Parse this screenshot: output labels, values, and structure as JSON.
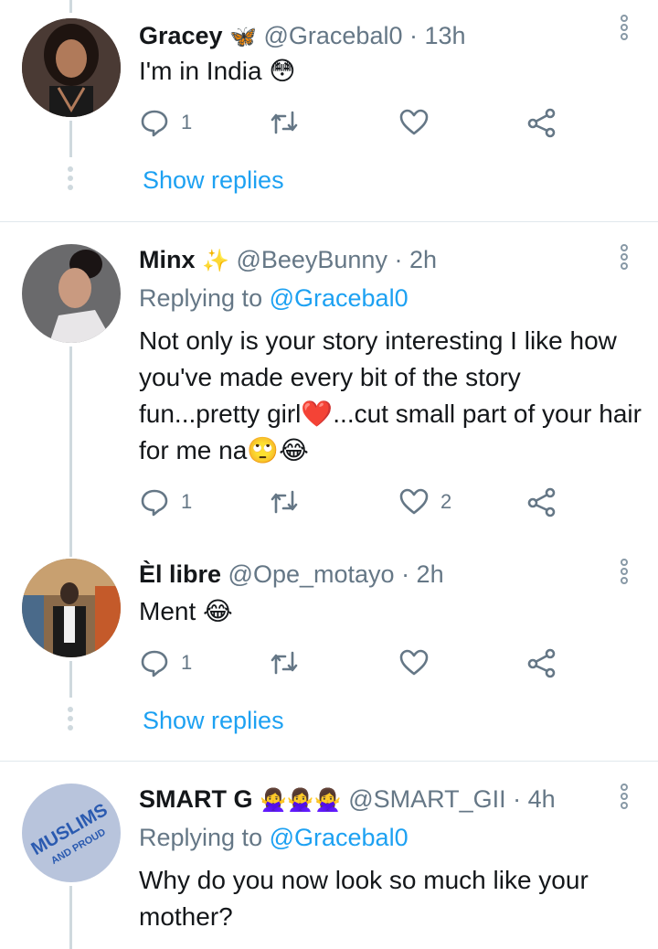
{
  "tweets": [
    {
      "name": "Gracey",
      "name_emoji": "🦋",
      "handle": "@Graceba l0",
      "time": "· 13h",
      "replying_prefix": "",
      "replying_to": "",
      "text": "I'm in India 😳",
      "replies": "1",
      "likes": "",
      "show_replies": "Show replies"
    },
    {
      "name": "Minx",
      "name_emoji": "✨",
      "handle": "@BeeyBunny",
      "time": "· 2h",
      "replying_prefix": "Replying to",
      "replying_to": "@Gracebal0",
      "text": "Not only is your story interesting I like how you've made every bit of the story fun...pretty girl❤️...cut small part of your hair for me na🙄😂",
      "replies": "1",
      "likes": "2",
      "show_replies": ""
    },
    {
      "name": "Èl libre",
      "name_emoji": "",
      "handle": "@Ope_motayo",
      "time": "· 2h",
      "replying_prefix": "",
      "replying_to": "",
      "text": "Ment 😂",
      "replies": "1",
      "likes": "",
      "show_replies": "Show replies"
    },
    {
      "name": "SMART G",
      "name_emoji": "🙅‍♀️🙅‍♀️🙅‍♀️",
      "handle": "@SMART_GII",
      "time": "· 4h",
      "replying_prefix": "Replying to",
      "replying_to": "@Gracebal0",
      "text": "Why do you now look so much like your mother?",
      "replies": "",
      "likes": "",
      "show_replies": ""
    }
  ],
  "avatar4_text": "MUSLIMS",
  "avatar4_subtext": "AND PROUD",
  "colors": {
    "accent": "#1da1f2",
    "secondary": "#657786",
    "divider": "#e1e8ed",
    "thread": "#cfd9de"
  }
}
